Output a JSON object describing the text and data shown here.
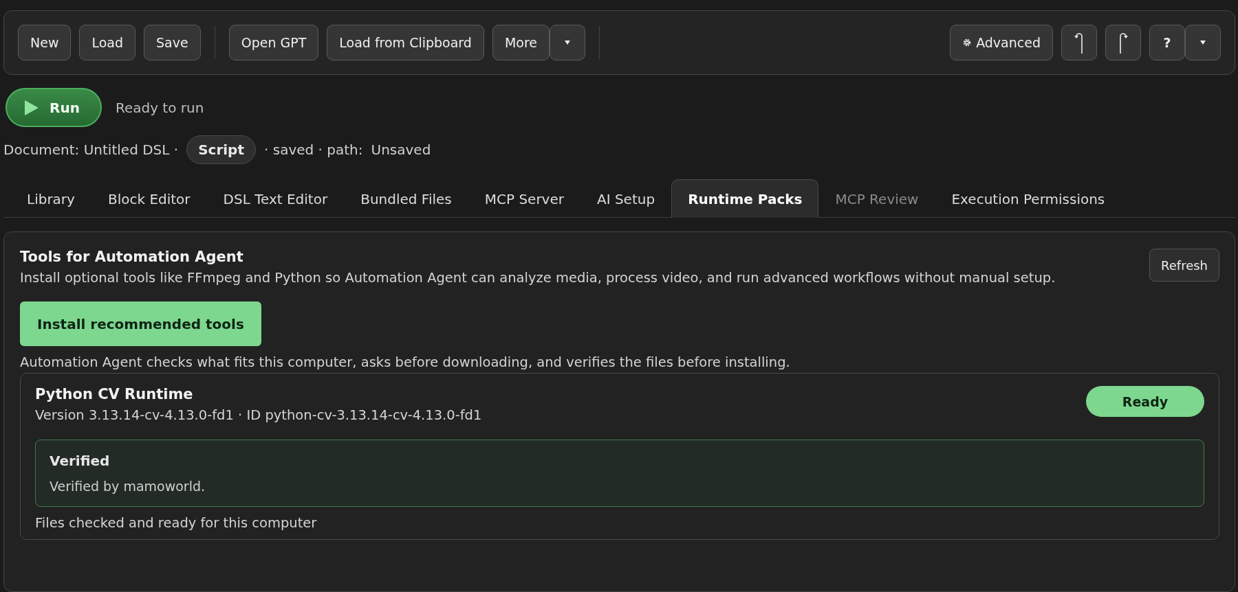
{
  "toolbar": {
    "left_buttons": [
      {
        "kind": "button",
        "label": "New"
      },
      {
        "kind": "button",
        "label": "Load"
      },
      {
        "kind": "button",
        "label": "Save"
      },
      {
        "kind": "divider"
      },
      {
        "kind": "button",
        "label": "Open GPT"
      },
      {
        "kind": "button",
        "label": "Load from Clipboard"
      },
      {
        "kind": "button",
        "label": "More"
      },
      {
        "kind": "caret"
      },
      {
        "kind": "divider"
      }
    ],
    "right_buttons": [
      {
        "kind": "gear-button",
        "label": "Advanced"
      },
      {
        "kind": "undo"
      },
      {
        "kind": "redo"
      },
      {
        "kind": "button",
        "label": "?"
      },
      {
        "kind": "caret"
      }
    ]
  },
  "run": {
    "label": "Run",
    "status": "Ready to run"
  },
  "document": {
    "prefix": "Document: Untitled DSL ·",
    "type": "Script",
    "saved": "· saved · path:",
    "path": "Unsaved"
  },
  "tabs": [
    {
      "label": "Library",
      "selected": false,
      "disabled": false
    },
    {
      "label": "Block Editor",
      "selected": false,
      "disabled": false
    },
    {
      "label": "DSL Text Editor",
      "selected": false,
      "disabled": false
    },
    {
      "label": "Bundled Files",
      "selected": false,
      "disabled": false
    },
    {
      "label": "MCP Server",
      "selected": false,
      "disabled": false
    },
    {
      "label": "AI Setup",
      "selected": false,
      "disabled": false
    },
    {
      "label": "Runtime Packs",
      "selected": true,
      "disabled": false
    },
    {
      "label": "MCP Review",
      "selected": false,
      "disabled": true
    },
    {
      "label": "Execution Permissions",
      "selected": false,
      "disabled": false
    }
  ],
  "panel": {
    "title": "Tools for Automation Agent",
    "description": "Install optional tools like FFmpeg and Python so Automation Agent can analyze media, process video, and run advanced workflows without manual setup.",
    "refresh": "Refresh",
    "install": "Install recommended tools",
    "note": "Automation Agent checks what fits this computer, asks before downloading, and verifies the files before installing.",
    "packs": [
      {
        "name": "Python CV Runtime",
        "meta": "Version 3.13.14-cv-4.13.0-fd1 · ID python-cv-3.13.14-cv-4.13.0-fd1",
        "status": "Ready",
        "ready": true,
        "verification": {
          "title": "Verified",
          "text": "Verified by mamoworld."
        },
        "footer": "Files checked and ready for this computer"
      }
    ]
  }
}
